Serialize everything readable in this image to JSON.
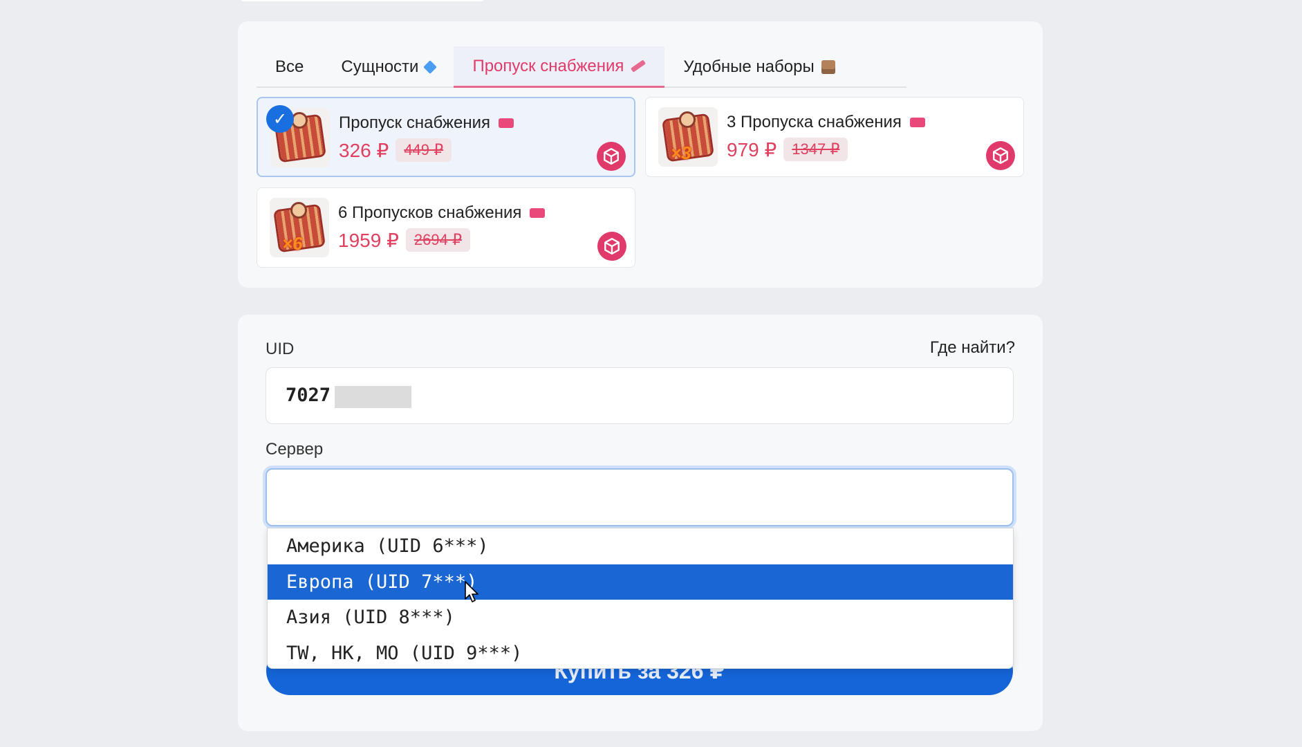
{
  "tabs": [
    {
      "label": "Все",
      "icon": ""
    },
    {
      "label": "Сущности",
      "icon": "diamond-icon"
    },
    {
      "label": "Пропуск снабжения",
      "icon": "pencil-icon"
    },
    {
      "label": "Удобные наборы",
      "icon": "box-icon"
    }
  ],
  "active_tab": 2,
  "products": [
    {
      "title": "Пропуск снабжения",
      "price": "326 ₽",
      "old_price": "449 ₽",
      "multiplier": "",
      "selected": true
    },
    {
      "title": "3 Пропуска снабжения",
      "price": "979 ₽",
      "old_price": "1347 ₽",
      "multiplier": "×3",
      "selected": false
    },
    {
      "title": "6 Пропусков снабжения",
      "price": "1959 ₽",
      "old_price": "2694 ₽",
      "multiplier": "×6",
      "selected": false
    }
  ],
  "form": {
    "uid_label": "UID",
    "where_find": "Где найти?",
    "uid_value": "7027",
    "server_label": "Сервер",
    "server_value": "",
    "server_options": [
      "Америка (UID 6***)",
      "Европа (UID 7***)",
      "Азия (UID 8***)",
      "TW, HK, MO (UID 9***)"
    ],
    "highlighted_option": 1,
    "buy_label": "Купить за 326 ₽"
  },
  "colors": {
    "accent_pink": "#e03a6a",
    "accent_blue": "#1565d8",
    "background": "#ebedf1"
  }
}
